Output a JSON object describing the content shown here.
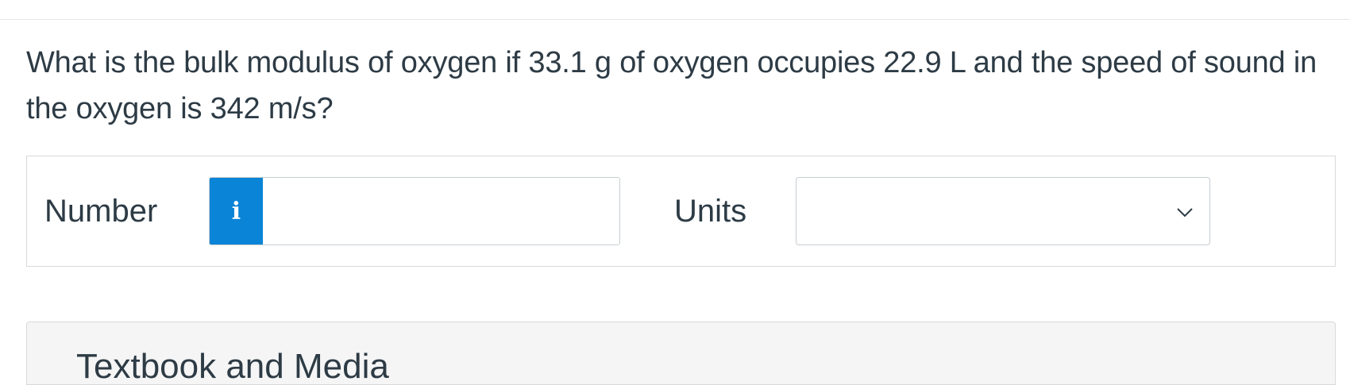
{
  "question": {
    "text": "What is the bulk modulus of oxygen if 33.1 g of oxygen occupies 22.9 L and the speed of sound in the oxygen is 342 m/s?"
  },
  "answer": {
    "number_label": "Number",
    "number_value": "",
    "info_button_glyph": "i",
    "info_icon": "info-icon",
    "units_label": "Units",
    "units_value": "",
    "units_icon": "chevron-down-icon"
  },
  "media_panel": {
    "title": "Textbook and Media"
  },
  "colors": {
    "info_button": "#0a84d6",
    "text": "#2d3b45",
    "border": "#c7cdd1",
    "panel_background": "#f5f5f5"
  }
}
